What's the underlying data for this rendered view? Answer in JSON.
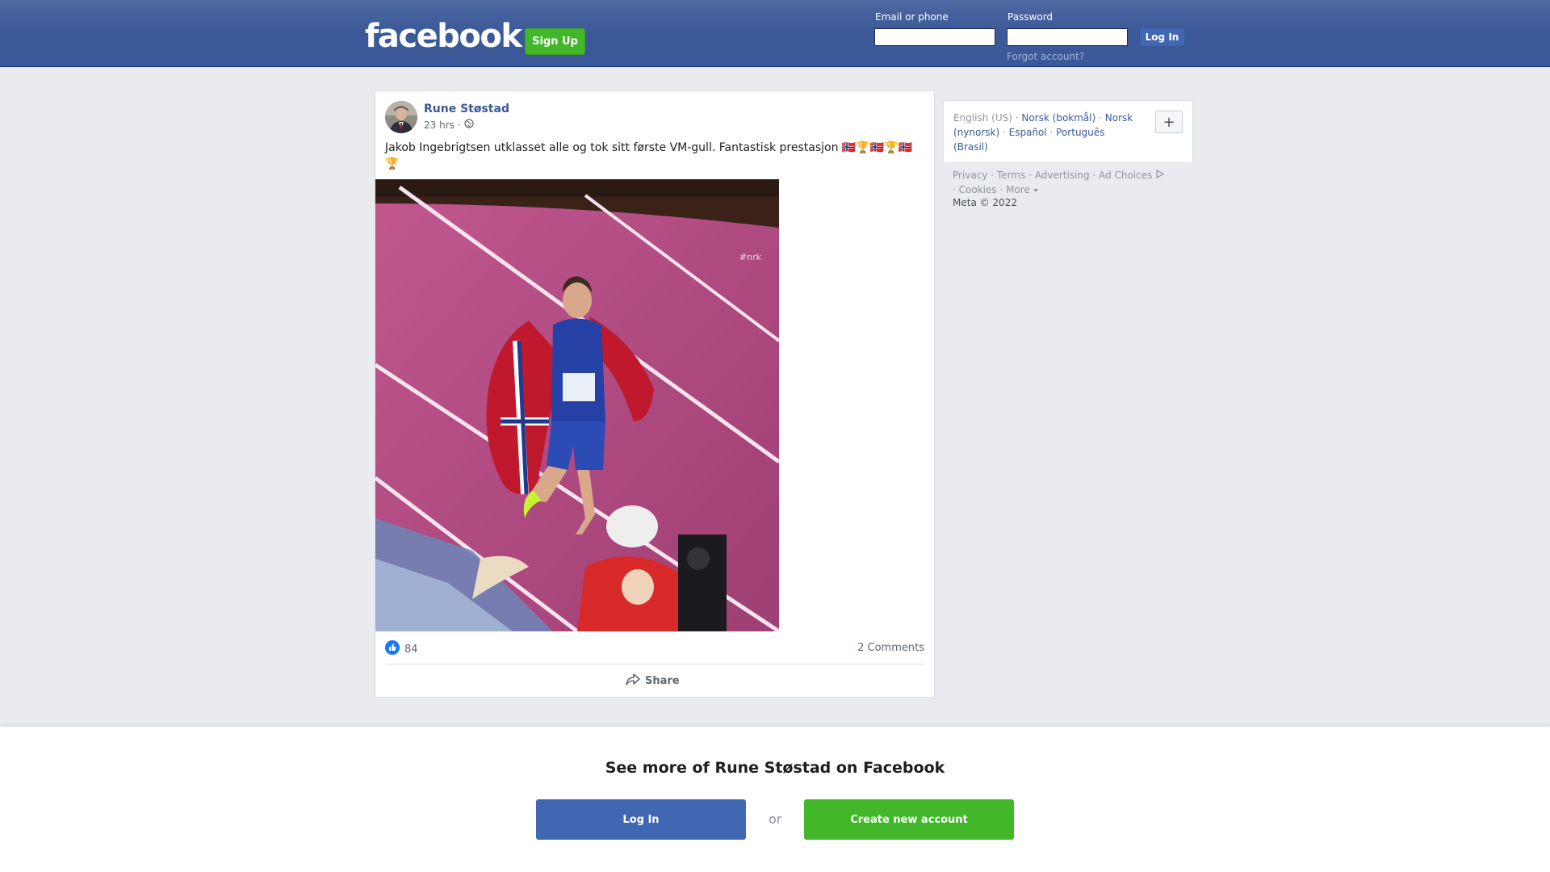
{
  "header": {
    "logo_text": "facebook",
    "signup_label": "Sign Up",
    "email_label": "Email or phone",
    "password_label": "Password",
    "login_label": "Log In",
    "forgot_label": "Forgot account?"
  },
  "post": {
    "author": "Rune Støstad",
    "time": "23 hrs",
    "separator": "·",
    "text": "Jakob Ingebrigtsen utklasset alle og tok sitt første VM-gull. Fantastisk prestasjon 🇳🇴🏆🇳🇴🏆🇳🇴🏆",
    "photo_watermark": "#nrk",
    "reaction_count": "84",
    "comments_label": "2 Comments",
    "share_label": "Share"
  },
  "sidebar": {
    "languages": {
      "current": "English (US)",
      "options": [
        "Norsk (bokmål)",
        "Norsk (nynorsk)",
        "Español",
        "Português (Brasil)"
      ]
    },
    "more_languages_label": "+",
    "footer_links": [
      "Privacy",
      "Terms",
      "Advertising",
      "Ad Choices",
      "Cookies",
      "More"
    ],
    "copyright": "Meta © 2022"
  },
  "bottom_sheet": {
    "title": "See more of Rune Støstad on Facebook",
    "login_label": "Log In",
    "or_label": "or",
    "create_label": "Create new account"
  },
  "colors": {
    "header_blue": "#3b5998",
    "button_blue": "#4267b2",
    "signup_green": "#42b72a",
    "link_blue": "#385898"
  }
}
